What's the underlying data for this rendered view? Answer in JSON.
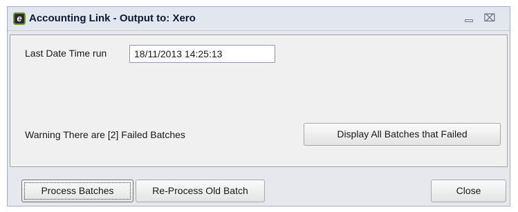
{
  "window": {
    "title": "Accounting Link - Output to: Xero",
    "icon": "app-logo-icon",
    "controls": {
      "minimize_icon": "minimize-icon",
      "close_icon": "close-x-icon",
      "close_glyph": "⌧"
    }
  },
  "form": {
    "last_run_label": "Last Date Time run",
    "last_run_value": "18/11/2013 14:25:13",
    "warning_text": "Warning There are [2] Failed Batches",
    "display_failed_label": "Display All Batches that Failed"
  },
  "footer": {
    "process_label": "Process Batches",
    "reprocess_label": "Re-Process Old Batch",
    "close_label": "Close"
  }
}
